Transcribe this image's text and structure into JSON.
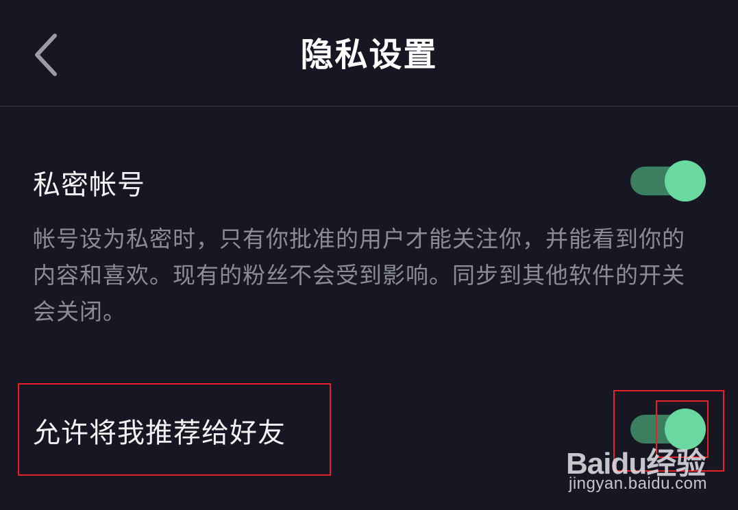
{
  "header": {
    "title": "隐私设置",
    "back_icon": "chevron-left-icon"
  },
  "settings": [
    {
      "label": "私密帐号",
      "description": "帐号设为私密时，只有你批准的用户才能关注你，并能看到你的内容和喜欢。现有的粉丝不会受到影响。同步到其他软件的开关会关闭。",
      "enabled": true
    },
    {
      "label": "允许将我推荐给好友",
      "enabled": true
    }
  ],
  "colors": {
    "background": "#161722",
    "divider": "#2b2c36",
    "toggle_track_on": "#3c7f60",
    "toggle_knob_on": "#6ad89f",
    "annotation": "#e3222b"
  },
  "watermark": {
    "logo": "Baidu经验",
    "url": "jingyan.baidu.com"
  }
}
